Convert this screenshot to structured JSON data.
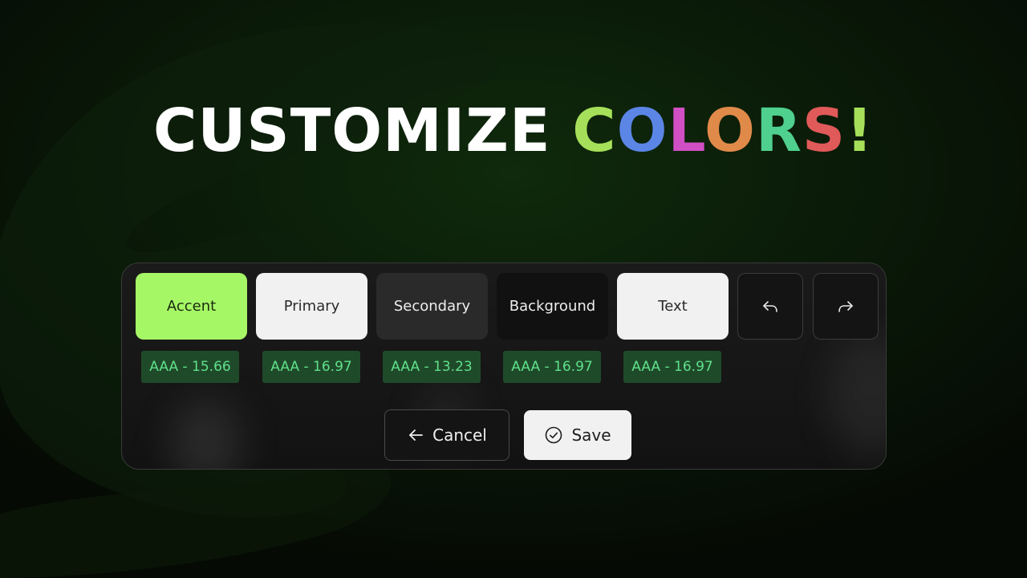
{
  "headline": {
    "main": "CUSTOMIZE",
    "highlight_letters": [
      {
        "char": "C",
        "color": "#a6e05a"
      },
      {
        "char": "O",
        "color": "#5b86e6"
      },
      {
        "char": "L",
        "color": "#d04fc4"
      },
      {
        "char": "O",
        "color": "#e08a4a"
      },
      {
        "char": "R",
        "color": "#4fd08e"
      },
      {
        "char": "S",
        "color": "#e05a5a"
      },
      {
        "char": "!",
        "color": "#a6e05a"
      }
    ]
  },
  "swatches": [
    {
      "label": "Accent",
      "color": "#a6f766"
    },
    {
      "label": "Primary",
      "color": "#f1f1f1"
    },
    {
      "label": "Secondary",
      "color": "#2a2a2a"
    },
    {
      "label": "Background",
      "color": "#111111"
    },
    {
      "label": "Text",
      "color": "#f1f1f1"
    }
  ],
  "contrast_badges": [
    "AAA - 15.66",
    "AAA - 16.97",
    "AAA - 13.23",
    "AAA - 16.97",
    "AAA - 16.97"
  ],
  "controls": {
    "undo_icon": "undo-arrow-icon",
    "redo_icon": "redo-arrow-icon"
  },
  "actions": {
    "cancel_label": "Cancel",
    "cancel_icon": "arrow-left-icon",
    "save_label": "Save",
    "save_icon": "check-circle-icon"
  },
  "colors": {
    "page_background": "#050a04",
    "badge_background": "#1f4a2a",
    "badge_text": "#5fe08a"
  }
}
